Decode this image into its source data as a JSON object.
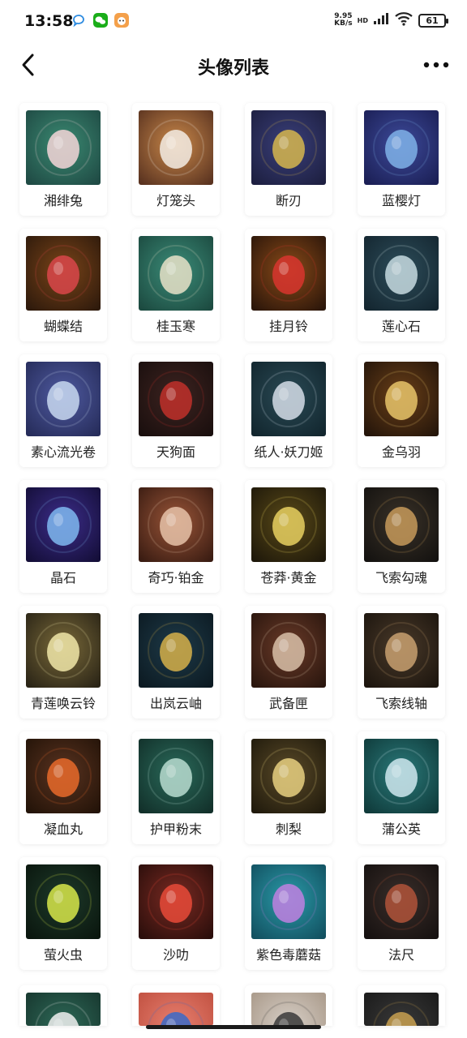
{
  "status_bar": {
    "time": "13:58",
    "net_speed_value": "9.95",
    "net_speed_unit": "KB/s",
    "hd": "HD",
    "battery": "61"
  },
  "nav": {
    "title": "头像列表"
  },
  "avatars": [
    {
      "label": "湘绯兔",
      "colors": [
        "#3b8a72",
        "#1f4a44"
      ],
      "accent": "#f4d6d8"
    },
    {
      "label": "灯笼头",
      "colors": [
        "#c9884a",
        "#5a3320"
      ],
      "accent": "#f3ece4"
    },
    {
      "label": "断刃",
      "colors": [
        "#3a3f7a",
        "#1d1f40"
      ],
      "accent": "#d6b64e"
    },
    {
      "label": "蓝樱灯",
      "colors": [
        "#3d4a9a",
        "#1b1f55"
      ],
      "accent": "#7fb2e8"
    },
    {
      "label": "蝴蝶结",
      "colors": [
        "#7a4418",
        "#2e1a0c"
      ],
      "accent": "#d9474a"
    },
    {
      "label": "桂玉寒",
      "colors": [
        "#3b8c78",
        "#1c4a40"
      ],
      "accent": "#e8e2c8"
    },
    {
      "label": "挂月铃",
      "colors": [
        "#8a4a18",
        "#2b160a"
      ],
      "accent": "#d8352e"
    },
    {
      "label": "莲心石",
      "colors": [
        "#2d4d5a",
        "#142630"
      ],
      "accent": "#c7dbe0"
    },
    {
      "label": "素心流光卷",
      "colors": [
        "#4f5aa0",
        "#262c5a"
      ],
      "accent": "#c8d8f0"
    },
    {
      "label": "天狗面",
      "colors": [
        "#3d2320",
        "#1a0f0e"
      ],
      "accent": "#c0302a"
    },
    {
      "label": "纸人·妖刀姬",
      "colors": [
        "#2a4a55",
        "#12262e"
      ],
      "accent": "#d5dde8"
    },
    {
      "label": "金乌羽",
      "colors": [
        "#6a3f18",
        "#24150a"
      ],
      "accent": "#e8c46a"
    },
    {
      "label": "晶石",
      "colors": [
        "#3c2d8a",
        "#140e38"
      ],
      "accent": "#7fb8f0"
    },
    {
      "label": "奇巧·铂金",
      "colors": [
        "#9a5538",
        "#3a1c12"
      ],
      "accent": "#e6c2a8"
    },
    {
      "label": "苍莽·黄金",
      "colors": [
        "#5a4a18",
        "#1e180a"
      ],
      "accent": "#e8d060"
    },
    {
      "label": "飞索勾魂",
      "colors": [
        "#3a3228",
        "#141210"
      ],
      "accent": "#c79a5a"
    },
    {
      "label": "青莲唤云铃",
      "colors": [
        "#7a6a3a",
        "#2a2416"
      ],
      "accent": "#f0e6a8"
    },
    {
      "label": "出岚云岫",
      "colors": [
        "#1e3a48",
        "#0c1a22"
      ],
      "accent": "#d6b04a"
    },
    {
      "label": "武备匣",
      "colors": [
        "#6a3a28",
        "#2a160e"
      ],
      "accent": "#d8c0a8"
    },
    {
      "label": "飞索线轴",
      "colors": [
        "#4a3a2a",
        "#1c150e"
      ],
      "accent": "#c8a070"
    },
    {
      "label": "凝血丸",
      "colors": [
        "#5a3320",
        "#231308"
      ],
      "accent": "#e86a2a"
    },
    {
      "label": "护甲粉末",
      "colors": [
        "#2a6a5a",
        "#12302a"
      ],
      "accent": "#b8dcd0"
    },
    {
      "label": "刺梨",
      "colors": [
        "#5a4a28",
        "#201a0c"
      ],
      "accent": "#e8d080"
    },
    {
      "label": "蒲公英",
      "colors": [
        "#2a7a7a",
        "#0f3a3a"
      ],
      "accent": "#cfe8ee"
    },
    {
      "label": "萤火虫",
      "colors": [
        "#1e3a2a",
        "#0a160e"
      ],
      "accent": "#d8e84a"
    },
    {
      "label": "沙叻",
      "colors": [
        "#7a2a22",
        "#2a0e0b"
      ],
      "accent": "#e84a38"
    },
    {
      "label": "紫色毒蘑菇",
      "colors": [
        "#2a9aa8",
        "#125060"
      ],
      "accent": "#c080e0"
    },
    {
      "label": "法尺",
      "colors": [
        "#3a2e2a",
        "#161110"
      ],
      "accent": "#b0543a"
    }
  ],
  "partial_avatars": [
    {
      "colors": [
        "#2e6a58",
        "#17362e"
      ],
      "accent": "#f0f0f0"
    },
    {
      "colors": [
        "#e88070",
        "#c05040"
      ],
      "accent": "#3a6ac8"
    },
    {
      "colors": [
        "#d8d0c8",
        "#a89888"
      ],
      "accent": "#3a3a3a"
    },
    {
      "colors": [
        "#3a3a3a",
        "#1a1a1a"
      ],
      "accent": "#c8a050"
    }
  ]
}
